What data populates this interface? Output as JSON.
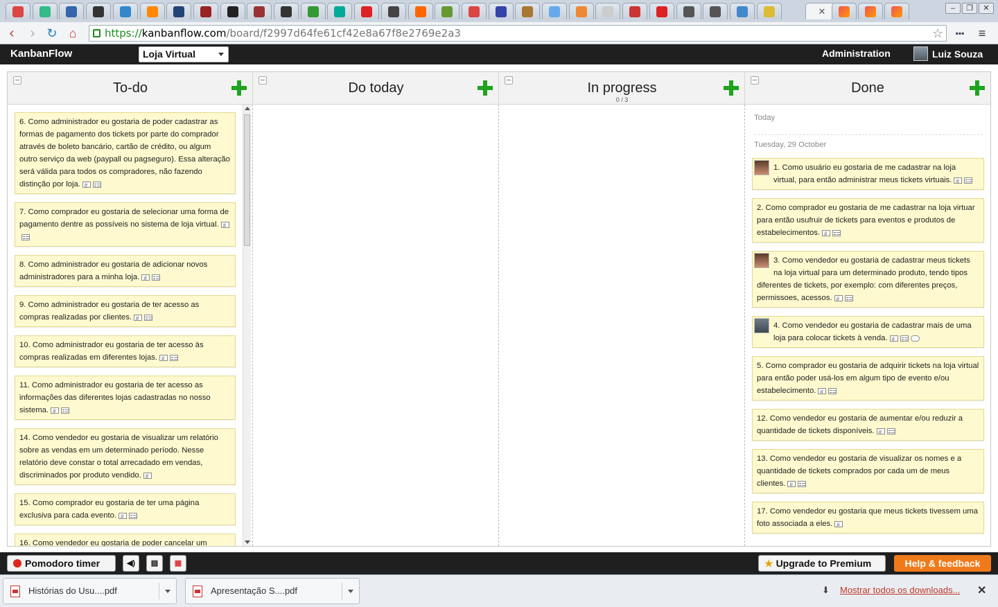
{
  "browser": {
    "url_scheme": "https://",
    "url_host": "kanbanflow.com",
    "url_path": "/board/f2997d64fe61cf42e8a67f8e2769e2a3",
    "tab_colors": [
      "#d44",
      "#3b8",
      "#36a",
      "#333",
      "#38c",
      "#f80",
      "#247",
      "#922",
      "#222",
      "#933",
      "#333",
      "#393",
      "#0a9",
      "#d22",
      "#444",
      "#f60",
      "#693",
      "#d44",
      "#34a",
      "#a73",
      "#6ae",
      "#e83",
      "#ccc",
      "#c33",
      "#d22",
      "#555",
      "#555",
      "#48c",
      "#db3"
    ]
  },
  "header": {
    "logo": "KanbanFlow",
    "board_name": "Loja Virtual",
    "admin": "Administration",
    "user_name": "Luiz Souza"
  },
  "columns": [
    {
      "title": "To-do",
      "sub": ""
    },
    {
      "title": "Do today",
      "sub": ""
    },
    {
      "title": "In progress",
      "sub": "0 / 3"
    },
    {
      "title": "Done",
      "sub": ""
    }
  ],
  "todo": [
    "6. Como administrador eu gostaria de poder cadastrar as formas de pagamento dos tickets por parte do comprador através de boleto bancário, cartão de crédito, ou algum outro serviço da web (paypall ou pagseguro). Essa alteração será válida para todos os compradores, não fazendo distinção por loja.",
    "7. Como comprador eu gostaria de selecionar uma forma de pagamento dentre as possíveis no sistema de loja virtual.",
    "8. Como administrador eu gostaria de adicionar novos administradores para a minha loja.",
    "9. Como administrador eu gostaria de ter acesso as compras realizadas por clientes.",
    "10. Como administrador eu gostaria de ter acesso às compras realizadas em diferentes lojas.",
    "11. Como administrador eu gostaria de ter acesso as informações das diferentes lojas cadastradas no nosso sistema.",
    "14. Como vendedor eu gostaria de visualizar um relatório sobre as vendas em um determinado período. Nesse relatório deve constar o total arrecadado em vendas, discriminados por produto vendido.",
    "15. Como comprador eu gostaria de ter uma página exclusiva para cada evento.",
    "16. Como vendedor eu gostaria de poder cancelar um"
  ],
  "done_today_label": "Today",
  "done_date_label": "Tuesday, 29 October",
  "done": [
    "1. Como usuário eu gostaria de me cadastrar na loja virtual, para então administrar meus tickets virtuais.",
    "2. Como comprador eu gostaria de me cadastrar na loja virtuar para então usufruir de tickets para eventos e produtos de estabelecimentos.",
    "3. Como vendedor eu gostaria de cadastrar meus tickets na loja virtual para um determinado produto, tendo tipos diferentes de tickets, por exemplo: com diferentes preços, permissoes, acessos.",
    "4. Como vendedor eu gostaria de cadastrar mais de uma loja para colocar tickets à venda.",
    "5. Como comprador eu gostaria de adquirir tickets na loja virtual para então poder usá-los em algum tipo de evento e/ou estabelecimento.",
    "12. Como vendedor eu gostaria de aumentar e/ou reduzir a quantidade de tickets disponíveis.",
    "13. Como vendedor eu gostaria de visualizar os nomes e a quantidade de tickets comprados por cada um de meus clientes.",
    "17. Como vendedor eu gostaria que meus tickets tivessem uma foto associada a eles."
  ],
  "footer": {
    "pomodoro": "Pomodoro timer",
    "upgrade": "Upgrade to Premium",
    "help": "Help & feedback"
  },
  "downloads": {
    "file1": "Histórias do Usu....pdf",
    "file2": "Apresentação S....pdf",
    "show_all": "Mostrar todos os downloads..."
  }
}
